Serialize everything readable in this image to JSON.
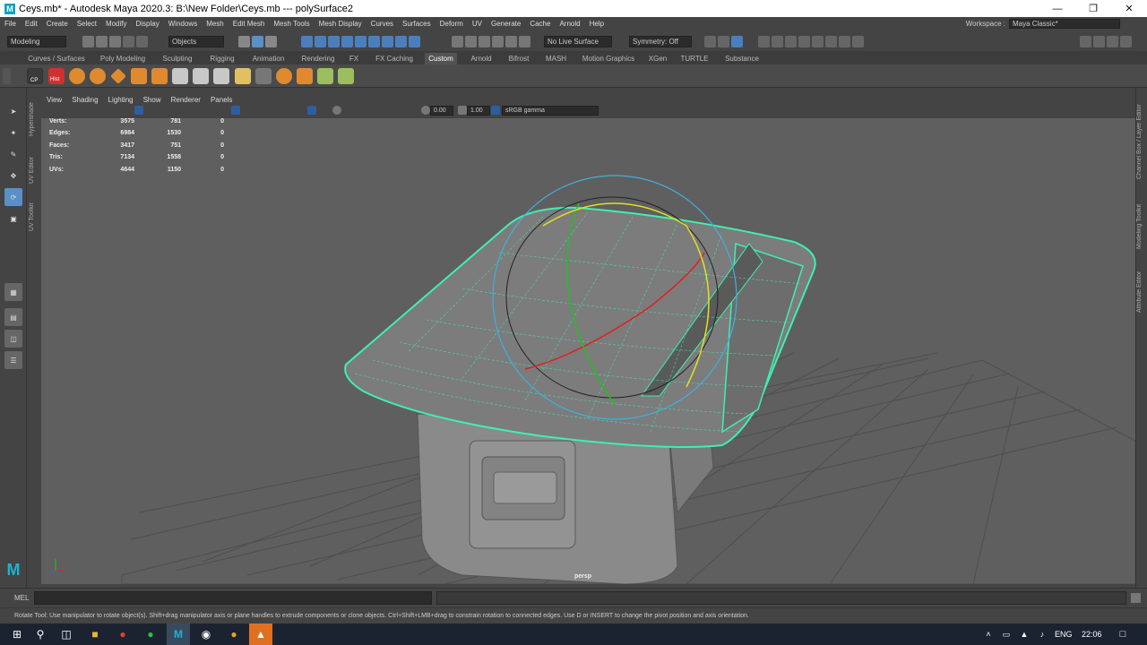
{
  "window": {
    "title": "Ceys.mb* - Autodesk Maya 2020.3: B:\\New Folder\\Ceys.mb   ---   polySurface2",
    "logo": "M"
  },
  "menubar": [
    "File",
    "Edit",
    "Create",
    "Select",
    "Modify",
    "Display",
    "Windows",
    "Mesh",
    "Edit Mesh",
    "Mesh Tools",
    "Mesh Display",
    "Curves",
    "Surfaces",
    "Deform",
    "UV",
    "Generate",
    "Cache",
    "Arnold",
    "Help"
  ],
  "workspace": {
    "label": "Workspace :",
    "value": "Maya Classic*"
  },
  "statusline": {
    "mode": "Modeling",
    "select": "Objects",
    "live_surface": "No Live Surface",
    "symmetry": "Symmetry: Off"
  },
  "shelf_tabs": [
    "Curves / Surfaces",
    "Poly Modeling",
    "Sculpting",
    "Rigging",
    "Animation",
    "Rendering",
    "FX",
    "FX Caching",
    "Custom",
    "Arnold",
    "Bifrost",
    "MASH",
    "Motion Graphics",
    "XGen",
    "TURTLE",
    "Substance"
  ],
  "active_shelf_tab": "Custom",
  "shelf_labels": {
    "cp": "CP",
    "hist": "Hist"
  },
  "viewport_menu": [
    "View",
    "Shading",
    "Lighting",
    "Show",
    "Renderer",
    "Panels"
  ],
  "viewport_toolbar": {
    "exposure": "0.00",
    "gamma": "1.00",
    "colorspace": "sRGB gamma"
  },
  "hud": [
    {
      "label": "Verts:",
      "v1": "3575",
      "v2": "781",
      "v3": "0"
    },
    {
      "label": "Edges:",
      "v1": "6984",
      "v2": "1530",
      "v3": "0"
    },
    {
      "label": "Faces:",
      "v1": "3417",
      "v2": "751",
      "v3": "0"
    },
    {
      "label": "Tris:",
      "v1": "7134",
      "v2": "1558",
      "v3": "0"
    },
    {
      "label": "UVs:",
      "v1": "4644",
      "v2": "1150",
      "v3": "0"
    }
  ],
  "camera_label": "persp",
  "side_tabs_left": [
    "Hypershade",
    "UV Editor",
    "UV Toolkit"
  ],
  "side_tabs_right": [
    "Channel Box / Layer Editor",
    "Modeling Toolkit",
    "Attribute Editor"
  ],
  "cmdline": {
    "lang": "MEL"
  },
  "helpline": "Rotate Tool: Use manipulator to rotate object(s). Shift+drag manipulator axis or plane handles to extrude components or clone objects. Ctrl+Shift+LMB+drag to constrain rotation to connected edges. Use D or INSERT to change the pivot position and axis orientation.",
  "taskbar": {
    "lang": "ENG",
    "time": "22:06"
  },
  "colors": {
    "viewport_bg": "#5f5f5f",
    "wireframe": "#3ef0b0",
    "manip_x": "#e02020",
    "manip_y": "#20c020",
    "manip_z": "#e0e020",
    "manip_view": "#40b0e0"
  }
}
